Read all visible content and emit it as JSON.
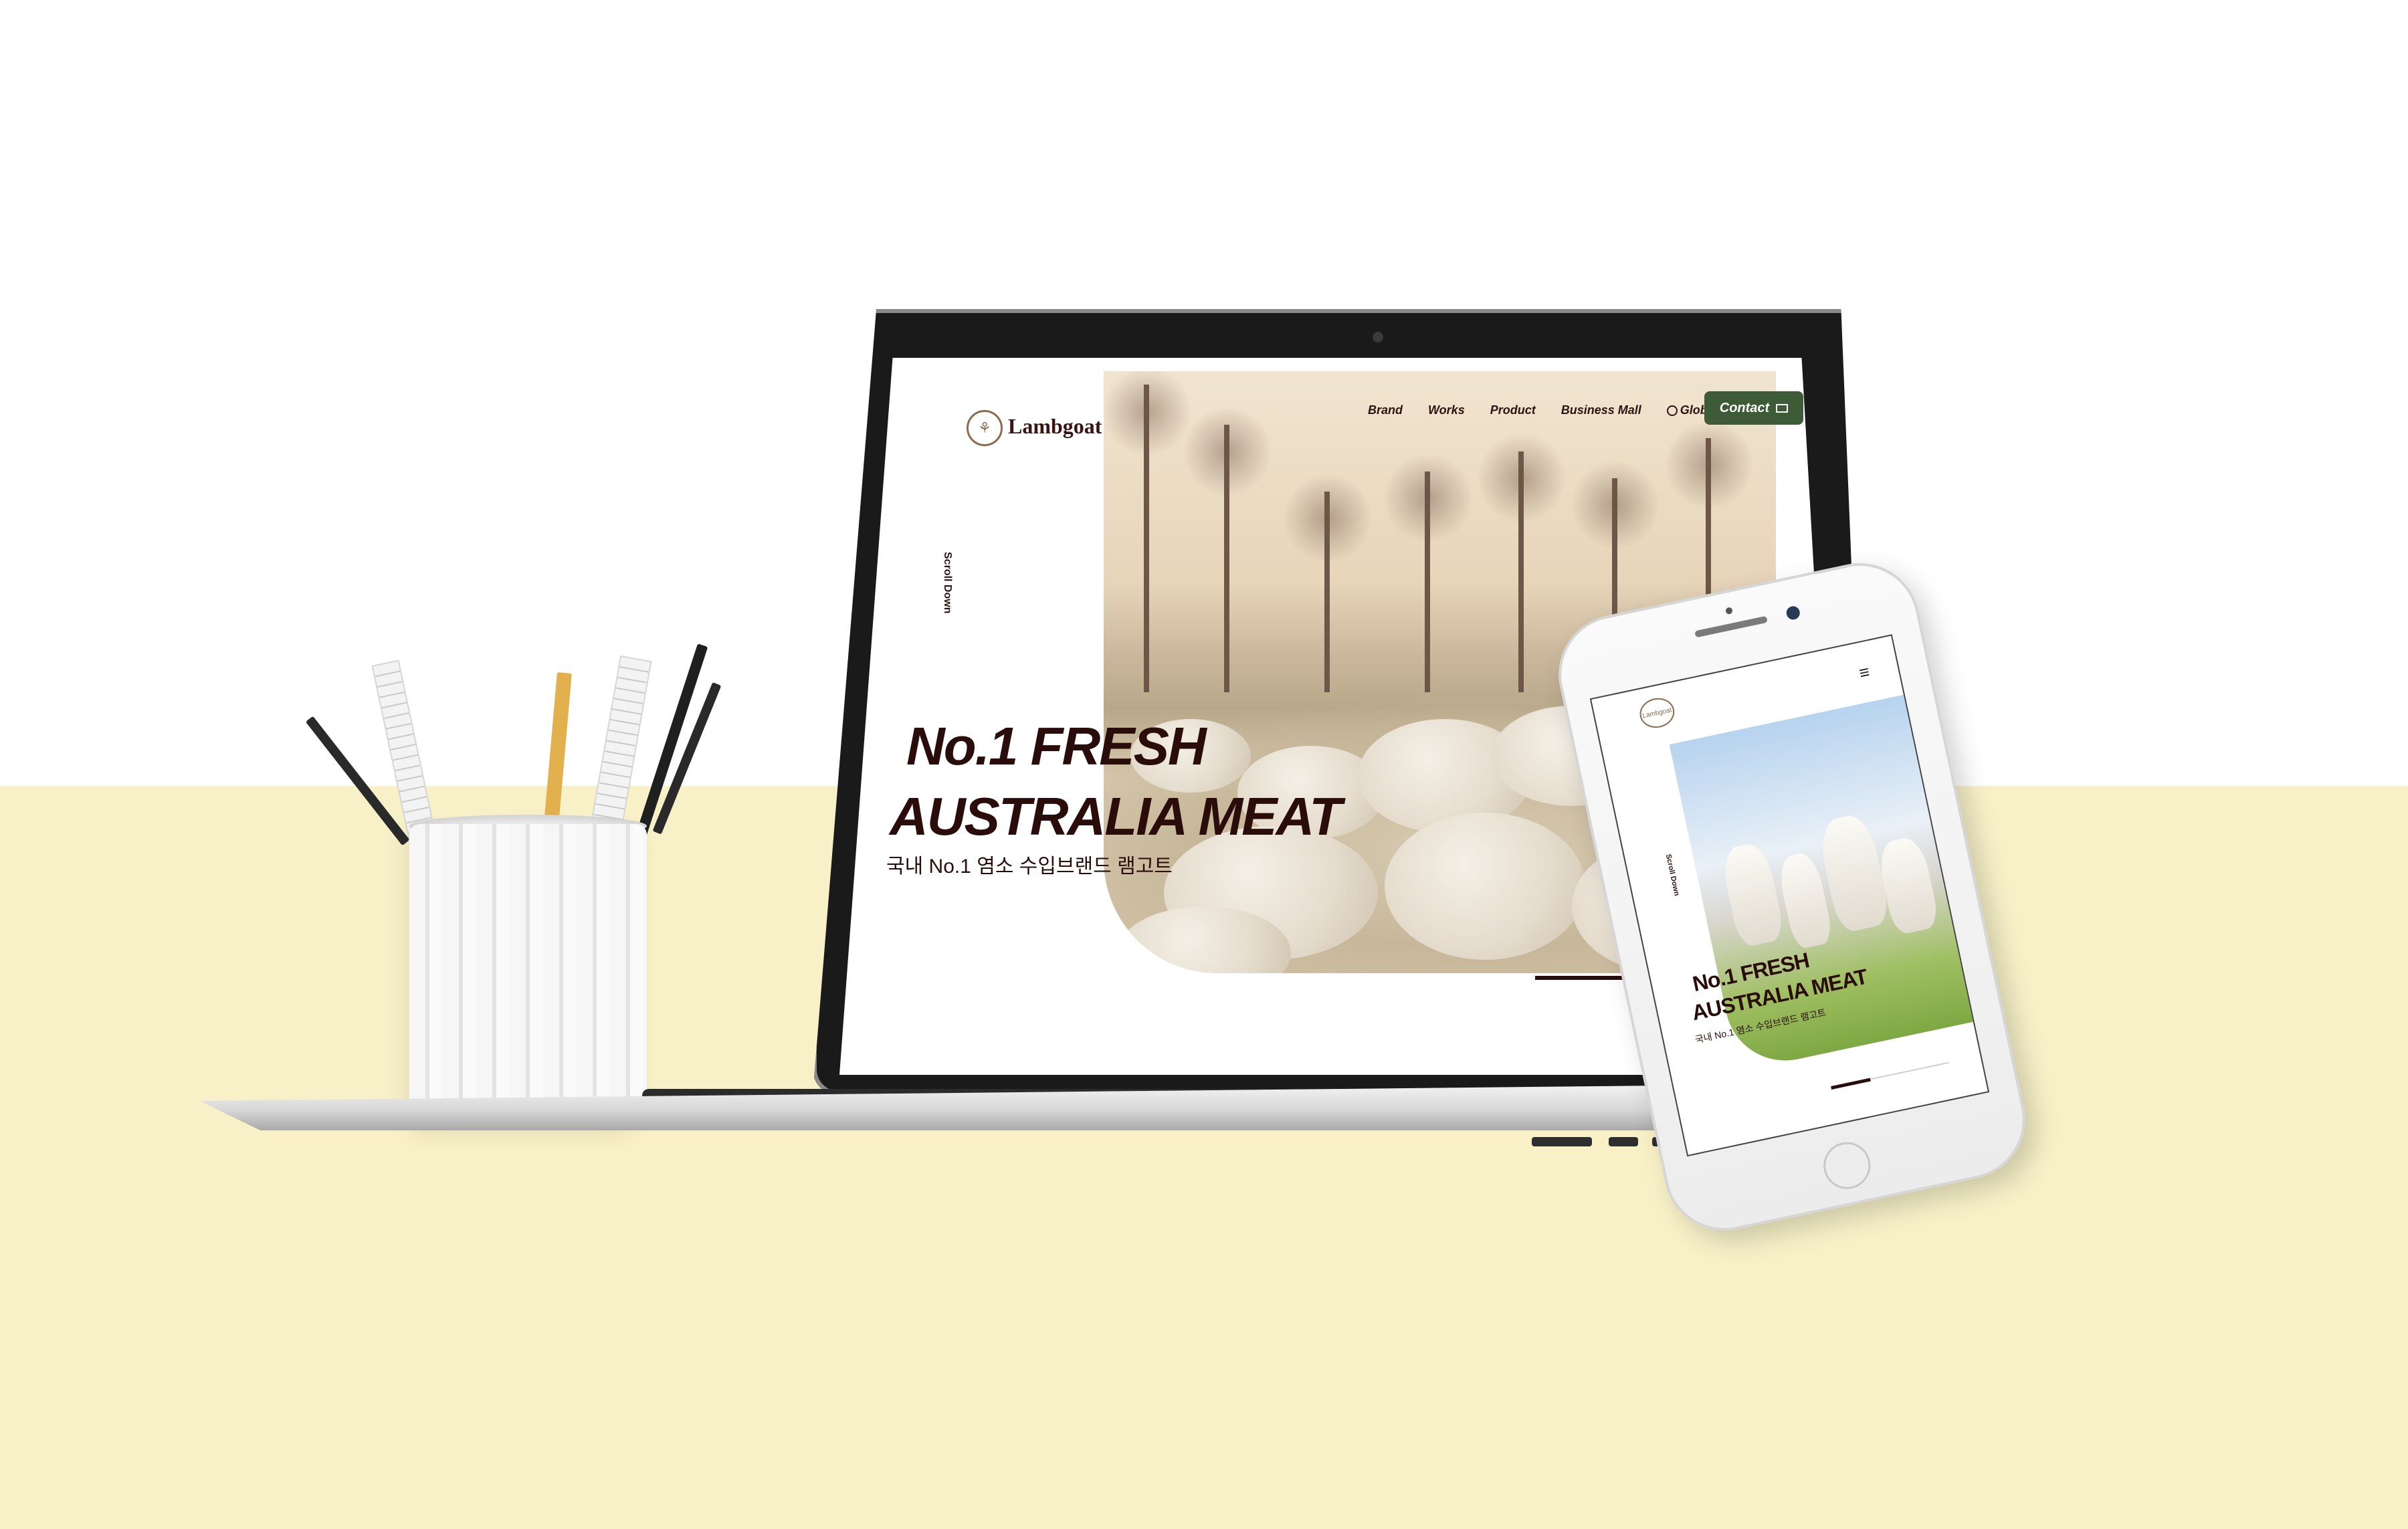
{
  "site": {
    "logo_text": "Lambgoat",
    "nav": [
      "Brand",
      "Works",
      "Product",
      "Business Mall"
    ],
    "global_label": "Global",
    "contact_label": "Contact",
    "scroll_label": "Scroll Down",
    "hero_line1": "No.1 FRESH",
    "hero_line2": "AUSTRALIA MEAT",
    "hero_sub": "국내 No.1 염소 수입브랜드 램고트"
  },
  "mobile": {
    "logo_text": "Lambgoat",
    "scroll_label": "Scroll Down",
    "hero_line1": "No.1 FRESH",
    "hero_line2": "AUSTRALIA MEAT",
    "hero_sub": "국내 No.1 염소 수입브랜드 램고트"
  },
  "colors": {
    "background_top": "#ffffff",
    "floor": "#f8f1c8",
    "text_dark": "#2a0d0b",
    "contact_button": "#3d5b37",
    "logo_brown": "#8b6b4f"
  },
  "icons": {
    "globe": "globe-icon",
    "mail": "mail-icon",
    "menu": "hamburger-menu-icon"
  }
}
